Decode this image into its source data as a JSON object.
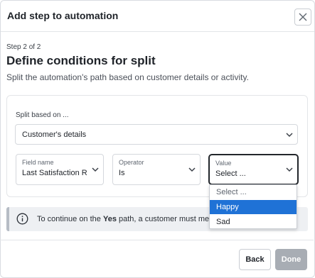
{
  "dialog": {
    "title": "Add step to automation",
    "close_icon": "close-icon"
  },
  "step": {
    "label": "Step 2 of 2",
    "title": "Define conditions for split",
    "description": "Split the automation's path based on customer details or activity."
  },
  "split": {
    "label": "Split based on ...",
    "value": "Customer's details"
  },
  "condition": {
    "field_name": {
      "label": "Field name",
      "value": "Last Satisfaction Ra"
    },
    "operator": {
      "label": "Operator",
      "value": "Is"
    },
    "value": {
      "label": "Value",
      "value": "Select ..."
    }
  },
  "dropdown": {
    "options": [
      "Select ...",
      "Happy",
      "Sad"
    ],
    "highlighted": "Happy",
    "highlight_color": "#1f72d6"
  },
  "info": {
    "icon": "info-icon",
    "text_before": "To continue on the ",
    "text_bold": "Yes",
    "text_after": " path, a customer must me"
  },
  "footer": {
    "back_label": "Back",
    "done_label": "Done"
  }
}
